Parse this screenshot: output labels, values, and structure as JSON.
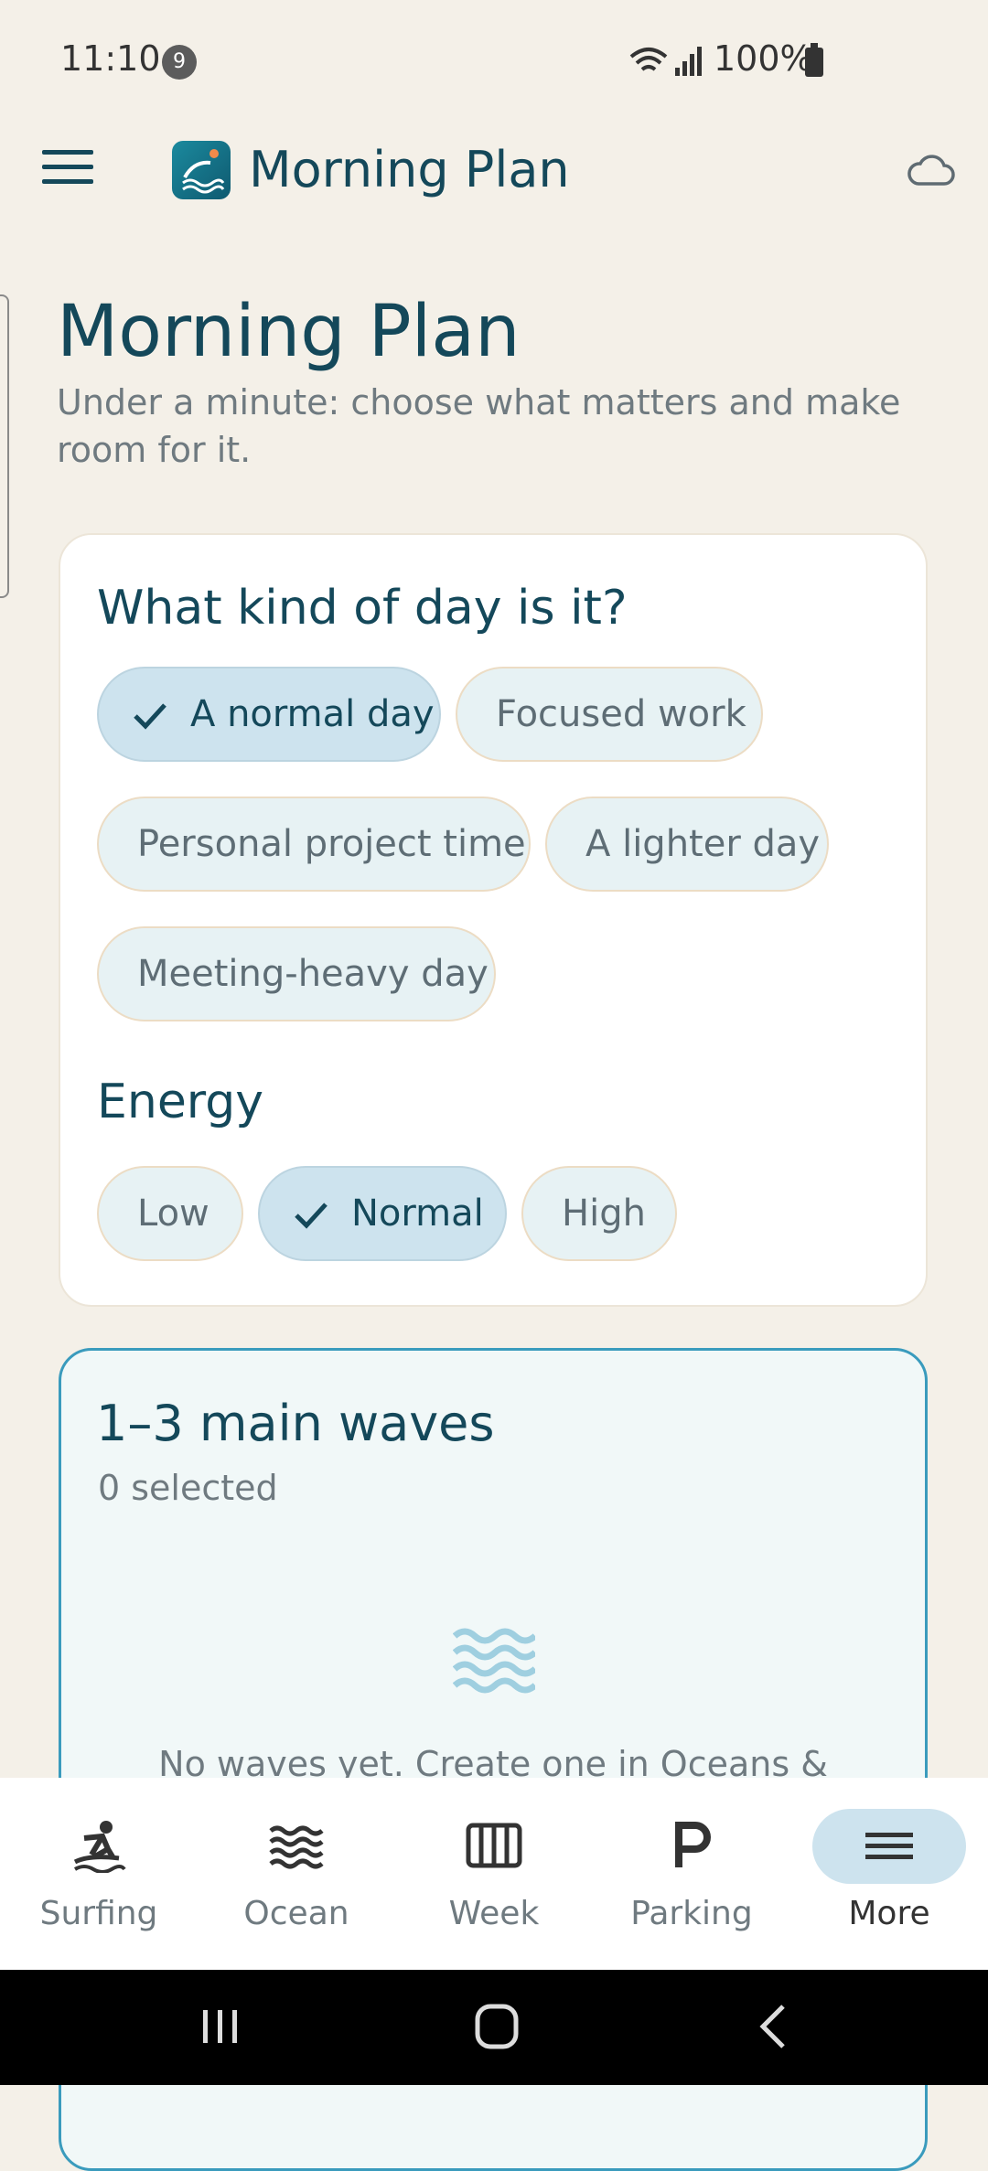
{
  "status": {
    "time": "11:10",
    "badge": "9",
    "battery": "100%"
  },
  "app_bar": {
    "title": "Morning Plan"
  },
  "page": {
    "title": "Morning Plan",
    "subtitle": "Under a minute: choose what matters and make room for it."
  },
  "day_card": {
    "heading": "What kind of day is it?",
    "options": [
      "A normal day",
      "Focused work",
      "Personal project time",
      "A lighter day",
      "Meeting-heavy day"
    ],
    "selected": "A normal day",
    "energy_heading": "Energy",
    "energy_options": [
      "Low",
      "Normal",
      "High"
    ],
    "energy_selected": "Normal"
  },
  "waves_card": {
    "title": "1–3 main waves",
    "count": "0 selected",
    "empty": "No waves yet. Create one in Oceans &"
  },
  "nav": {
    "items": [
      "Surfing",
      "Ocean",
      "Week",
      "Parking",
      "More"
    ],
    "active": "More"
  },
  "colors": {
    "accent": "#14485a",
    "chip_selected": "#cde3ee",
    "chip": "#e7f2f4",
    "card_border": "#3a9bbd"
  }
}
